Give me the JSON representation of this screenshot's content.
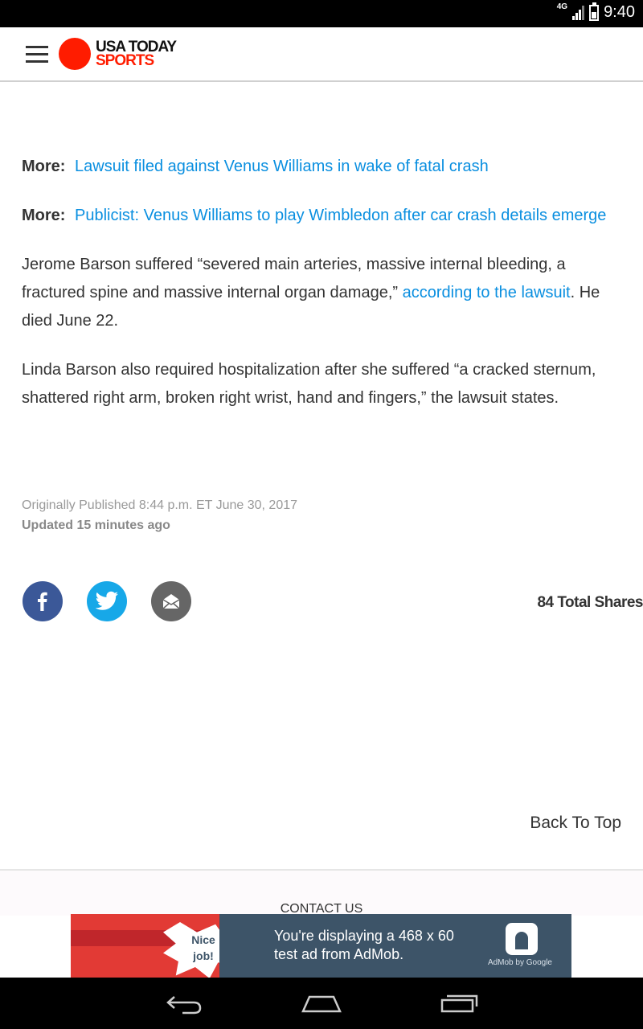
{
  "status_bar": {
    "network": "4G",
    "time": "9:40"
  },
  "app_bar": {
    "brand_line1": "USA TODAY",
    "brand_line2": "SPORTS"
  },
  "article": {
    "more1": {
      "label": "More:",
      "link": "Lawsuit filed against Venus Williams in wake of fatal crash"
    },
    "more2": {
      "label": "More:",
      "link": "Publicist: Venus Williams to play Wimbledon after car crash details emerge"
    },
    "para1": {
      "text_before": "Jerome Barson suffered “severed main arteries, massive internal bleeding, a fractured spine and massive internal organ damage,” ",
      "link": "according to the lawsuit",
      "text_after": ". He died June 22."
    },
    "para2": "Linda Barson also required hospitalization after she suffered “a cracked sternum, shattered right arm, broken right wrist, hand and fingers,” the lawsuit states."
  },
  "meta": {
    "published": "Originally Published 8:44 p.m. ET June 30, 2017",
    "updated": "Updated 15 minutes ago"
  },
  "share": {
    "total": "84 Total Shares",
    "icons": [
      "facebook-icon",
      "twitter-icon",
      "email-icon"
    ],
    "colors": {
      "facebook": "#3b5898",
      "twitter": "#17a8e8",
      "email": "#666666"
    }
  },
  "back_to_top": "Back To Top",
  "footer": {
    "contact": "CONTACT US"
  },
  "ad": {
    "badge_line1": "Nice",
    "badge_line2": "job!",
    "message_line1": "You're displaying a 468 x 60",
    "message_line2": "test ad from AdMob.",
    "brand": "AdMob by Google"
  },
  "colors": {
    "link": "#0a8fe0",
    "brand_red": "#ff1c00",
    "ad_panel": "#3d5468"
  }
}
